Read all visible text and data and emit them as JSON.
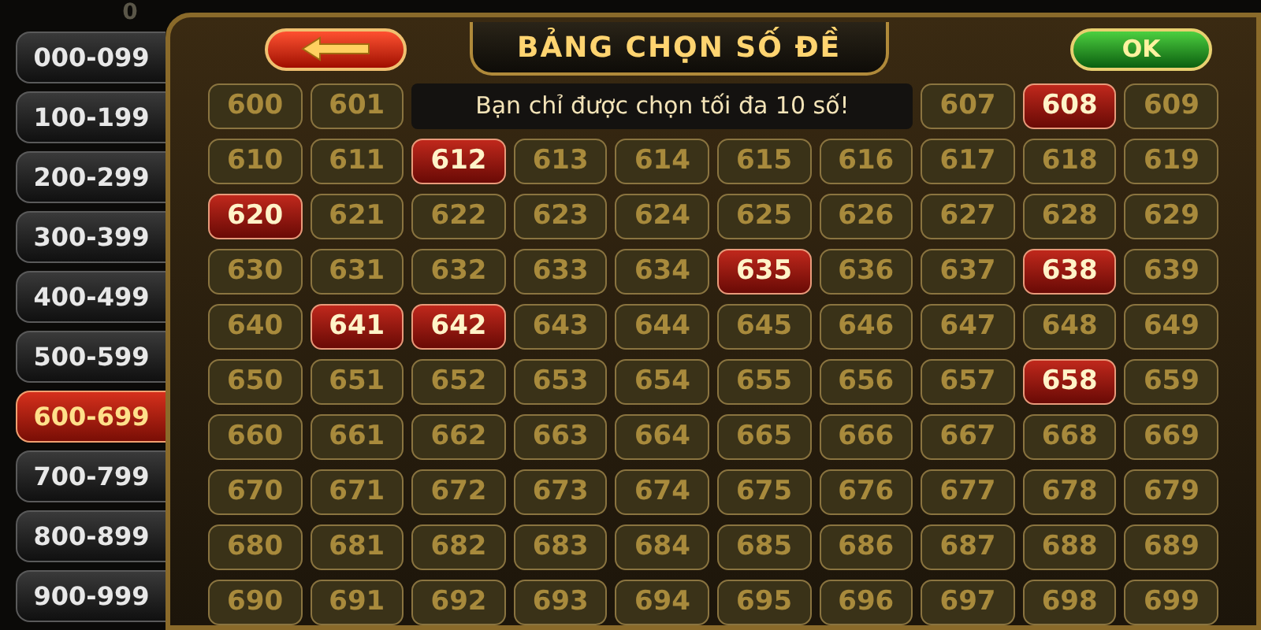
{
  "top_counter": "0",
  "ranges": [
    {
      "label": "000-099",
      "selected": false
    },
    {
      "label": "100-199",
      "selected": false
    },
    {
      "label": "200-299",
      "selected": false
    },
    {
      "label": "300-399",
      "selected": false
    },
    {
      "label": "400-499",
      "selected": false
    },
    {
      "label": "500-599",
      "selected": false
    },
    {
      "label": "600-699",
      "selected": true
    },
    {
      "label": "700-799",
      "selected": false
    },
    {
      "label": "800-899",
      "selected": false
    },
    {
      "label": "900-999",
      "selected": false
    }
  ],
  "title": "BẢNG CHỌN SỐ ĐỀ",
  "ok_button": "OK",
  "rows": [
    [
      {
        "label": "600",
        "selected": false
      },
      {
        "label": "601",
        "selected": false
      },
      {
        "kind": "toast",
        "text": "Bạn chỉ được chọn tối đa 10 số!"
      },
      {
        "label": "607",
        "selected": false
      },
      {
        "label": "608",
        "selected": true
      },
      {
        "label": "609",
        "selected": false
      }
    ],
    [
      {
        "label": "610",
        "selected": false
      },
      {
        "label": "611",
        "selected": false
      },
      {
        "label": "612",
        "selected": true
      },
      {
        "label": "613",
        "selected": false
      },
      {
        "label": "614",
        "selected": false
      },
      {
        "label": "615",
        "selected": false
      },
      {
        "label": "616",
        "selected": false
      },
      {
        "label": "617",
        "selected": false
      },
      {
        "label": "618",
        "selected": false
      },
      {
        "label": "619",
        "selected": false
      }
    ],
    [
      {
        "label": "620",
        "selected": true
      },
      {
        "label": "621",
        "selected": false
      },
      {
        "label": "622",
        "selected": false
      },
      {
        "label": "623",
        "selected": false
      },
      {
        "label": "624",
        "selected": false
      },
      {
        "label": "625",
        "selected": false
      },
      {
        "label": "626",
        "selected": false
      },
      {
        "label": "627",
        "selected": false
      },
      {
        "label": "628",
        "selected": false
      },
      {
        "label": "629",
        "selected": false
      }
    ],
    [
      {
        "label": "630",
        "selected": false
      },
      {
        "label": "631",
        "selected": false
      },
      {
        "label": "632",
        "selected": false
      },
      {
        "label": "633",
        "selected": false
      },
      {
        "label": "634",
        "selected": false
      },
      {
        "label": "635",
        "selected": true
      },
      {
        "label": "636",
        "selected": false
      },
      {
        "label": "637",
        "selected": false
      },
      {
        "label": "638",
        "selected": true
      },
      {
        "label": "639",
        "selected": false
      }
    ],
    [
      {
        "label": "640",
        "selected": false
      },
      {
        "label": "641",
        "selected": true
      },
      {
        "label": "642",
        "selected": true
      },
      {
        "label": "643",
        "selected": false
      },
      {
        "label": "644",
        "selected": false
      },
      {
        "label": "645",
        "selected": false
      },
      {
        "label": "646",
        "selected": false
      },
      {
        "label": "647",
        "selected": false
      },
      {
        "label": "648",
        "selected": false
      },
      {
        "label": "649",
        "selected": false
      }
    ],
    [
      {
        "label": "650",
        "selected": false
      },
      {
        "label": "651",
        "selected": false
      },
      {
        "label": "652",
        "selected": false
      },
      {
        "label": "653",
        "selected": false
      },
      {
        "label": "654",
        "selected": false
      },
      {
        "label": "655",
        "selected": false
      },
      {
        "label": "656",
        "selected": false
      },
      {
        "label": "657",
        "selected": false
      },
      {
        "label": "658",
        "selected": true
      },
      {
        "label": "659",
        "selected": false
      }
    ],
    [
      {
        "label": "660",
        "selected": false
      },
      {
        "label": "661",
        "selected": false
      },
      {
        "label": "662",
        "selected": false
      },
      {
        "label": "663",
        "selected": false
      },
      {
        "label": "664",
        "selected": false
      },
      {
        "label": "665",
        "selected": false
      },
      {
        "label": "666",
        "selected": false
      },
      {
        "label": "667",
        "selected": false
      },
      {
        "label": "668",
        "selected": false
      },
      {
        "label": "669",
        "selected": false
      }
    ],
    [
      {
        "label": "670",
        "selected": false
      },
      {
        "label": "671",
        "selected": false
      },
      {
        "label": "672",
        "selected": false
      },
      {
        "label": "673",
        "selected": false
      },
      {
        "label": "674",
        "selected": false
      },
      {
        "label": "675",
        "selected": false
      },
      {
        "label": "676",
        "selected": false
      },
      {
        "label": "677",
        "selected": false
      },
      {
        "label": "678",
        "selected": false
      },
      {
        "label": "679",
        "selected": false
      }
    ],
    [
      {
        "label": "680",
        "selected": false
      },
      {
        "label": "681",
        "selected": false
      },
      {
        "label": "682",
        "selected": false
      },
      {
        "label": "683",
        "selected": false
      },
      {
        "label": "684",
        "selected": false
      },
      {
        "label": "685",
        "selected": false
      },
      {
        "label": "686",
        "selected": false
      },
      {
        "label": "687",
        "selected": false
      },
      {
        "label": "688",
        "selected": false
      },
      {
        "label": "689",
        "selected": false
      }
    ],
    [
      {
        "label": "690",
        "selected": false
      },
      {
        "label": "691",
        "selected": false
      },
      {
        "label": "692",
        "selected": false
      },
      {
        "label": "693",
        "selected": false
      },
      {
        "label": "694",
        "selected": false
      },
      {
        "label": "695",
        "selected": false
      },
      {
        "label": "696",
        "selected": false
      },
      {
        "label": "697",
        "selected": false
      },
      {
        "label": "698",
        "selected": false
      },
      {
        "label": "699",
        "selected": false
      }
    ]
  ]
}
